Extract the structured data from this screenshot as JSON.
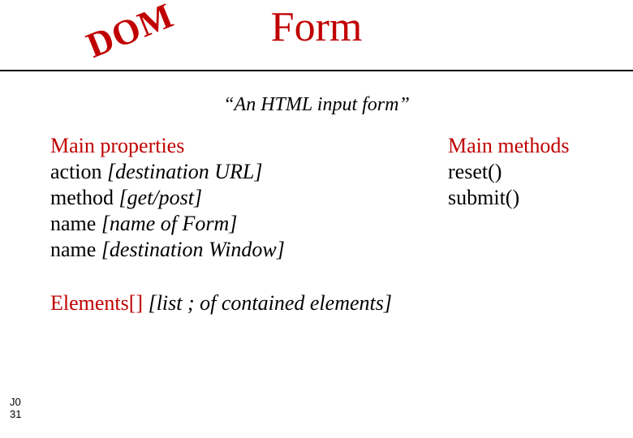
{
  "badge": "DOM",
  "title": "Form",
  "subtitle": "“An HTML input form”",
  "properties": {
    "heading": "Main properties",
    "items": [
      {
        "name": "action",
        "desc": "[destination URL]"
      },
      {
        "name": "method",
        "desc": "[get/post]"
      },
      {
        "name": "name",
        "desc": "[name of Form]"
      },
      {
        "name": "name",
        "desc": "[destination Window]"
      }
    ]
  },
  "methods": {
    "heading": "Main methods",
    "items": [
      {
        "name": "reset()"
      },
      {
        "name": "submit()"
      }
    ]
  },
  "elements": {
    "prefix": "Elements[] ",
    "desc": "[list ; of contained elements]"
  },
  "footer": {
    "code": "J0",
    "num": "31"
  }
}
